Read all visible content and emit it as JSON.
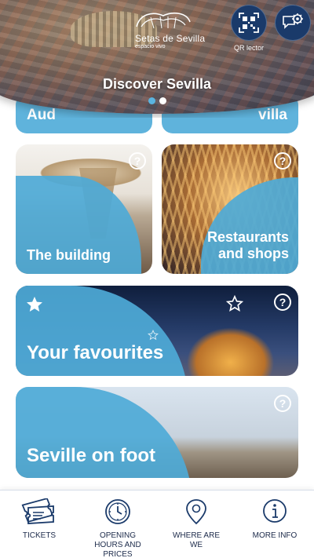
{
  "header": {
    "logo_title": "Setas de Sevilla",
    "logo_subtitle": "espacio vivo",
    "qr_label": "QR lector",
    "carousel_title": "Discover Sevilla",
    "carousel_pages": 2,
    "carousel_active_index": 0
  },
  "partial_row": {
    "left_text": "Aud",
    "right_text": "villa"
  },
  "cards": {
    "building": {
      "title": "The building"
    },
    "restaurants": {
      "title_line1": "Restaurants",
      "title_line2": "and shops"
    },
    "favourites": {
      "title": "Your favourites"
    },
    "foot": {
      "title": "Seville on foot"
    }
  },
  "nav": {
    "tickets": "TICKETS",
    "hours_line1": "OPENING",
    "hours_line2": "HOURS AND",
    "hours_line3": "PRICES",
    "where_line1": "WHERE ARE",
    "where_line2": "WE",
    "info": "MORE INFO"
  },
  "colors": {
    "brand_navy": "#1a3a6a",
    "card_blue": "#4eaad7",
    "nav_text": "#1c2a4a",
    "dot_active": "#5ab4e0"
  },
  "icons": [
    "qr-code-icon",
    "settings-chat-icon",
    "help-icon",
    "star-icon",
    "star-outline-icon",
    "ticket-icon",
    "clock-icon",
    "location-pin-icon",
    "info-icon"
  ]
}
